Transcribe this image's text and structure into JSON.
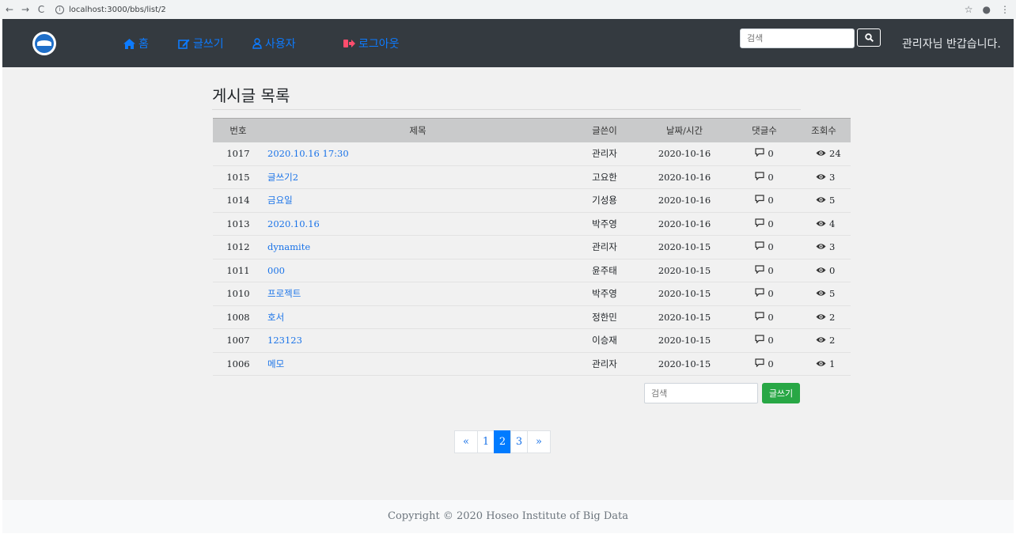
{
  "browser": {
    "url": "localhost:3000/bbs/list/2"
  },
  "nav": {
    "home": "홈",
    "write": "글쓰기",
    "users": "사용자",
    "logout": "로그아웃",
    "search_placeholder": "검색",
    "welcome": "관리자님 반갑습니다."
  },
  "page": {
    "title": "게시글 목록"
  },
  "table": {
    "headers": {
      "num": "번호",
      "title": "제목",
      "author": "글쓴이",
      "date": "날짜/시간",
      "comments": "댓글수",
      "views": "조회수"
    },
    "rows": [
      {
        "num": "1017",
        "title": "2020.10.16 17:30",
        "author": "관리자",
        "date": "2020-10-16",
        "comments": "0",
        "views": "24"
      },
      {
        "num": "1015",
        "title": "글쓰기2",
        "author": "고요한",
        "date": "2020-10-16",
        "comments": "0",
        "views": "3"
      },
      {
        "num": "1014",
        "title": "금요일",
        "author": "기성용",
        "date": "2020-10-16",
        "comments": "0",
        "views": "5"
      },
      {
        "num": "1013",
        "title": "2020.10.16",
        "author": "박주영",
        "date": "2020-10-16",
        "comments": "0",
        "views": "4"
      },
      {
        "num": "1012",
        "title": "dynamite",
        "author": "관리자",
        "date": "2020-10-15",
        "comments": "0",
        "views": "3"
      },
      {
        "num": "1011",
        "title": "000",
        "author": "윤주태",
        "date": "2020-10-15",
        "comments": "0",
        "views": "0"
      },
      {
        "num": "1010",
        "title": "프로젝트",
        "author": "박주영",
        "date": "2020-10-15",
        "comments": "0",
        "views": "5"
      },
      {
        "num": "1008",
        "title": "호서",
        "author": "정한민",
        "date": "2020-10-15",
        "comments": "0",
        "views": "2"
      },
      {
        "num": "1007",
        "title": "123123",
        "author": "이승재",
        "date": "2020-10-15",
        "comments": "0",
        "views": "2"
      },
      {
        "num": "1006",
        "title": "메모",
        "author": "관리자",
        "date": "2020-10-15",
        "comments": "0",
        "views": "1"
      }
    ]
  },
  "bottom": {
    "search_placeholder": "검색",
    "write_label": "글쓰기"
  },
  "pagination": {
    "prev": "«",
    "pages": [
      "1",
      "2",
      "3"
    ],
    "active": "2",
    "next": "»"
  },
  "footer": {
    "text": "Copyright © 2020 Hoseo Institute of Big Data"
  },
  "colors": {
    "navbar": "#343a40",
    "link": "#0d7bff",
    "write_button": "#28a745",
    "active_page": "#007bff"
  }
}
